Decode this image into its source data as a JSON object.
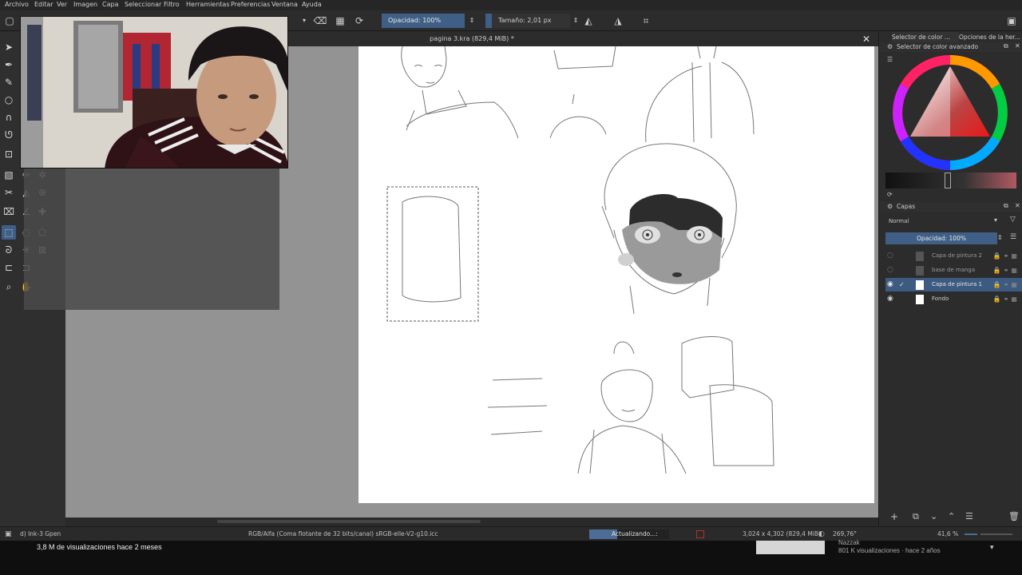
{
  "menu": [
    "Archivo",
    "Editar",
    "Ver",
    "Imagen",
    "Capa",
    "Seleccionar",
    "Filtro",
    "Herramientas",
    "Preferencias",
    "Ventana",
    "Ayuda"
  ],
  "toolbar": {
    "opacity_label": "Opacidad: 100%",
    "size_label": "Tamaño: 2,01 px"
  },
  "document": {
    "title": "pagina 3.kra (829,4 MiB) *"
  },
  "right_panel": {
    "tab_color": "Selector de color ...",
    "tab_options": "Opciones de la her...",
    "color_header": "Selector de color avanzado",
    "layers_header": "Capas",
    "blend_mode": "Normal",
    "layer_opacity": "Opacidad: 100%",
    "layers": [
      {
        "name": "Capa de pintura 2",
        "active": false,
        "visible": false
      },
      {
        "name": "base de manga",
        "active": false,
        "visible": false
      },
      {
        "name": "Capa de pintura 1",
        "active": true,
        "visible": true
      },
      {
        "name": "Fondo",
        "active": false,
        "visible": true
      }
    ]
  },
  "status": {
    "brush": "d) Ink-3 Gpen",
    "colorspace": "RGB/Alfa (Coma flotante de 32 bits/canal)  sRGB-elle-V2-g10.icc",
    "progress_text": "Actualizando...: 35%",
    "progress_value": 0.35,
    "dimensions": "3,024 x 4,302 (829,4 MiB)",
    "rotation": "269,76°",
    "zoom": "41,6 %"
  },
  "youtube": {
    "views_text": "3,8 M de visualizaciones  hace 2 meses",
    "channel_text": "Nazzak",
    "side_views_text": "801 K visualizaciones · hace 2 años"
  },
  "colors": {
    "accent": "#4d6d97",
    "panel_bg": "#2c2c2c",
    "canvas_bg": "#939393"
  }
}
